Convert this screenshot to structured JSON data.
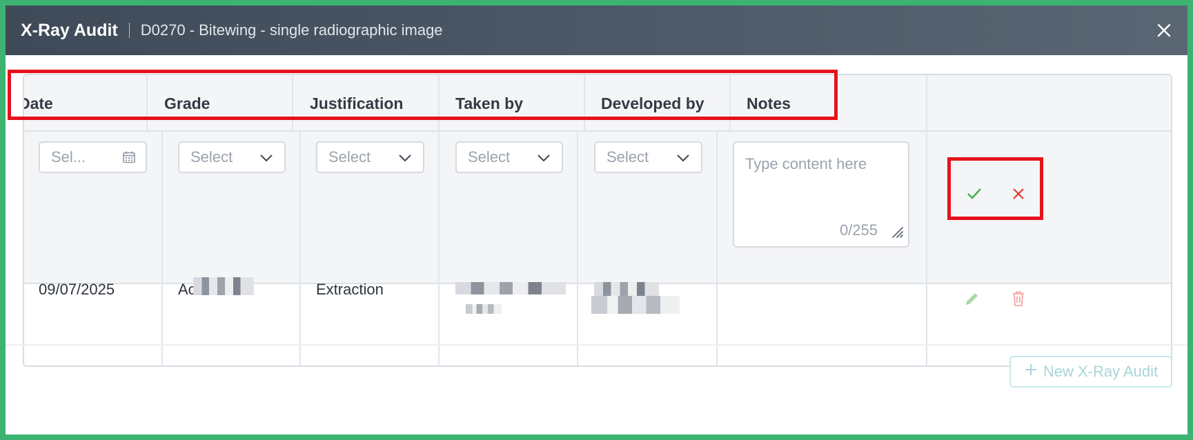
{
  "modal": {
    "title": "X-Ray Audit",
    "subtitle": "D0270 - Bitewing - single radiographic image"
  },
  "table": {
    "columns": [
      "Date",
      "Grade",
      "Justification",
      "Taken by",
      "Developed by",
      "Notes"
    ],
    "edit_row": {
      "date_placeholder": "Sel...",
      "grade_placeholder": "Select",
      "justification_placeholder": "Select",
      "taken_by_placeholder": "Select",
      "developed_by_placeholder": "Select",
      "notes_placeholder": "Type content here",
      "notes_counter": "0/255"
    },
    "rows": [
      {
        "date": "09/07/2025",
        "grade_prefix": "Ac",
        "justification": "Extraction"
      }
    ]
  },
  "footer": {
    "new_button_label": "New X-Ray Audit"
  },
  "colors": {
    "accept": "#4caf50",
    "reject": "#e53935",
    "edit": "#a8dba8",
    "delete": "#f1a7a4",
    "highlight": "#e5121b"
  }
}
